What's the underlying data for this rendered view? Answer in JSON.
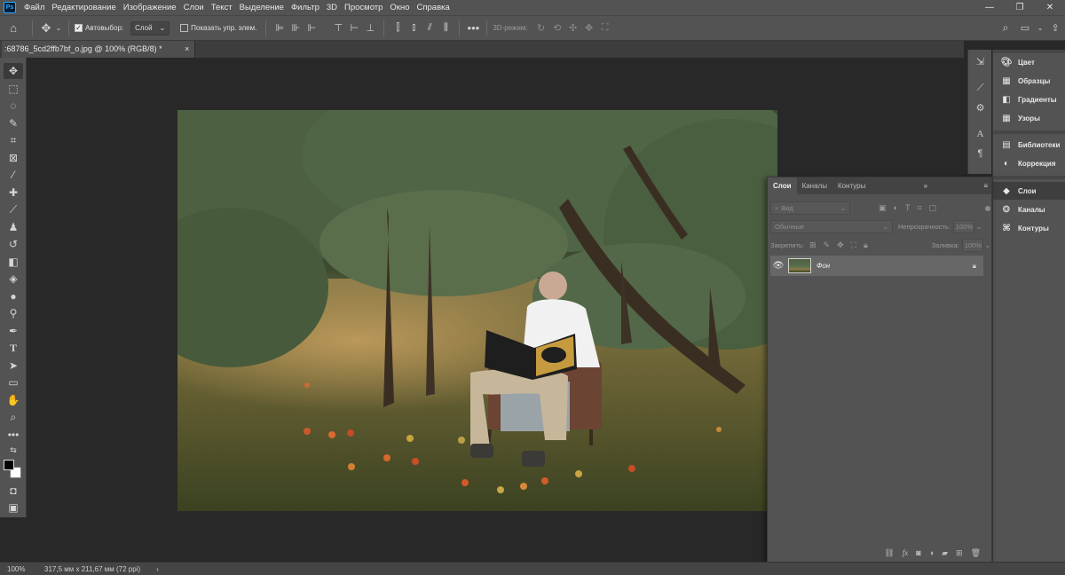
{
  "menubar": {
    "app_icon": "Ps",
    "items": [
      "Файл",
      "Редактирование",
      "Изображение",
      "Слои",
      "Текст",
      "Выделение",
      "Фильтр",
      "3D",
      "Просмотр",
      "Окно",
      "Справка"
    ],
    "window_controls": [
      "—",
      "❐",
      "✕"
    ]
  },
  "options": {
    "autoselect_label": "Автовыбор:",
    "autoselect_checked": true,
    "autoselect_target": "Слой",
    "show_transform_label": "Показать упр. элем.",
    "show_transform_checked": false,
    "mode_3d_label": "3D-режим:"
  },
  "document": {
    "tab_title": ":68786_5cd2ffb7bf_o.jpg @ 100% (RGB/8) *",
    "close_glyph": "×"
  },
  "status": {
    "zoom": "100%",
    "doc_size": "317,5 мм x 211,67 мм (72 ppi)",
    "arrow": "›"
  },
  "right_panels": {
    "items": [
      {
        "label": "Цвет",
        "icon": "palette-icon"
      },
      {
        "label": "Образцы",
        "icon": "grid-icon"
      },
      {
        "label": "Градиенты",
        "icon": "gradient-icon"
      },
      {
        "label": "Узоры",
        "icon": "pattern-icon"
      },
      {
        "label": "Библиотеки",
        "icon": "library-icon"
      },
      {
        "label": "Коррекция",
        "icon": "adjust-icon"
      },
      {
        "label": "Слои",
        "icon": "layers-icon"
      },
      {
        "label": "Каналы",
        "icon": "channels-icon"
      },
      {
        "label": "Контуры",
        "icon": "paths-icon"
      }
    ],
    "active": "Слои"
  },
  "layers_panel": {
    "tabs": [
      "Слои",
      "Каналы",
      "Контуры"
    ],
    "active_tab": "Слои",
    "collapse_glyph": "»",
    "menu_glyph": "≡",
    "filter_kind": "Вид",
    "blend_mode": "Обычные",
    "opacity_label": "Непрозрачность:",
    "opacity_value": "100%",
    "lock_label": "Закрепить:",
    "fill_label": "Заливка:",
    "fill_value": "100%",
    "layers": [
      {
        "name": "Фон",
        "visible": true,
        "locked": true
      }
    ]
  },
  "colors": {
    "chrome": "#535353",
    "canvas_bg": "#282828",
    "foreground": "#000000",
    "background": "#ffffff"
  }
}
